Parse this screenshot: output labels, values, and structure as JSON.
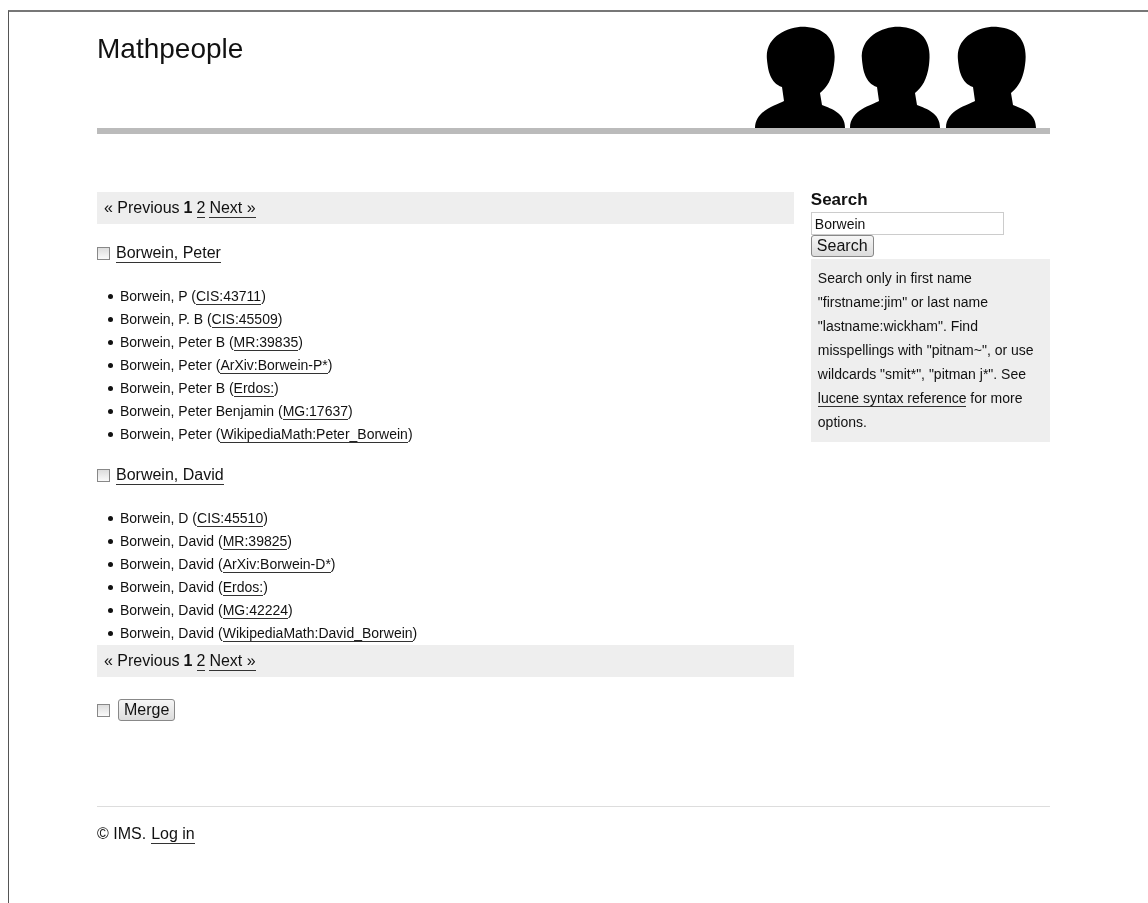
{
  "site_title": "Mathpeople",
  "pager_top": {
    "previous": "« Previous",
    "pages": [
      {
        "label": "1",
        "selected": true
      },
      {
        "label": "2",
        "selected": false
      }
    ],
    "next": "Next »"
  },
  "groups": [
    {
      "name": "Borwein, Peter",
      "checked": false,
      "entries": [
        {
          "prefix": "Borwein, P (",
          "link": "CIS:43711",
          "suffix": ")"
        },
        {
          "prefix": "Borwein, P. B (",
          "link": "CIS:45509",
          "suffix": ")"
        },
        {
          "prefix": "Borwein, Peter B (",
          "link": "MR:39835",
          "suffix": ")"
        },
        {
          "prefix": "Borwein, Peter (",
          "link": "ArXiv:Borwein-P*",
          "suffix": ")"
        },
        {
          "prefix": "Borwein, Peter B (",
          "link": "Erdos:",
          "suffix": ")"
        },
        {
          "prefix": "Borwein, Peter Benjamin (",
          "link": "MG:17637",
          "suffix": ")"
        },
        {
          "prefix": "Borwein, Peter (",
          "link": "WikipediaMath:Peter_Borwein",
          "suffix": ")"
        }
      ]
    },
    {
      "name": "Borwein, David",
      "checked": false,
      "entries": [
        {
          "prefix": "Borwein, D (",
          "link": "CIS:45510",
          "suffix": ")"
        },
        {
          "prefix": "Borwein, David (",
          "link": "MR:39825",
          "suffix": ")"
        },
        {
          "prefix": "Borwein, David (",
          "link": "ArXiv:Borwein-D*",
          "suffix": ")"
        },
        {
          "prefix": "Borwein, David (",
          "link": "Erdos:",
          "suffix": ")"
        },
        {
          "prefix": "Borwein, David (",
          "link": "MG:42224",
          "suffix": ")"
        },
        {
          "prefix": "Borwein, David (",
          "link": "WikipediaMath:David_Borwein",
          "suffix": ")"
        }
      ]
    }
  ],
  "pager_bottom": {
    "previous": "« Previous",
    "pages": [
      {
        "label": "1",
        "selected": true
      },
      {
        "label": "2",
        "selected": false
      }
    ],
    "next": "Next »"
  },
  "merge": {
    "checked": false,
    "button": "Merge"
  },
  "search": {
    "heading": "Search",
    "value": "Borwein",
    "button": "Search",
    "help_before": "Search only in first name \"firstname:jim\" or last name \"lastname:wickham\". Find misspellings with \"pitnam~\", or use wildcards \"smit*\", \"pitman j*\". See ",
    "help_link": "lucene syntax reference",
    "help_after": " for more options."
  },
  "footer": {
    "copyright": "© IMS.",
    "login": "Log in"
  }
}
